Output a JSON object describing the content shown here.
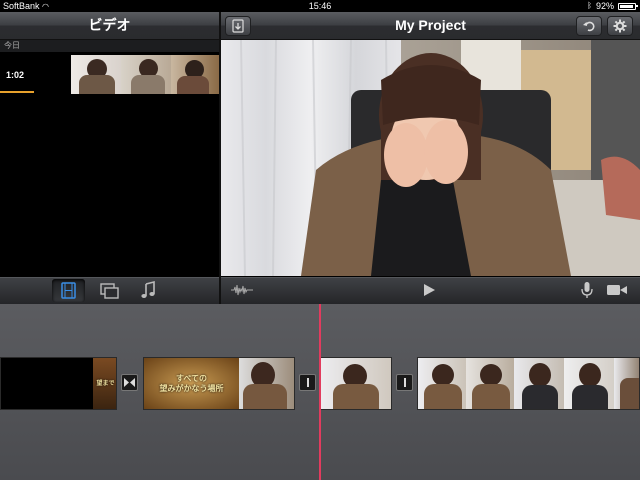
{
  "status_bar": {
    "carrier": "SoftBank",
    "time": "15:46",
    "battery": "92%"
  },
  "browser": {
    "title": "ビデオ",
    "section": "今日",
    "clip_duration": "1:02"
  },
  "project": {
    "title": "My Project"
  },
  "timeline": {
    "title_card_text_line1": "すべての",
    "title_card_text_line2": "望みがかなう場所",
    "title_side_text": "望まで"
  },
  "colors": {
    "accent": "#e7a12c",
    "playhead": "#e23b5e",
    "selected_tab": "#3a8ee6"
  },
  "icons": {
    "import": "import-icon",
    "undo": "undo-icon",
    "settings": "gear-icon",
    "video_tab": "film-icon",
    "photo_tab": "photos-icon",
    "audio_tab": "music-note-icon",
    "waveform": "waveform-icon",
    "play": "play-icon",
    "mic": "microphone-icon",
    "camera": "video-camera-icon"
  }
}
